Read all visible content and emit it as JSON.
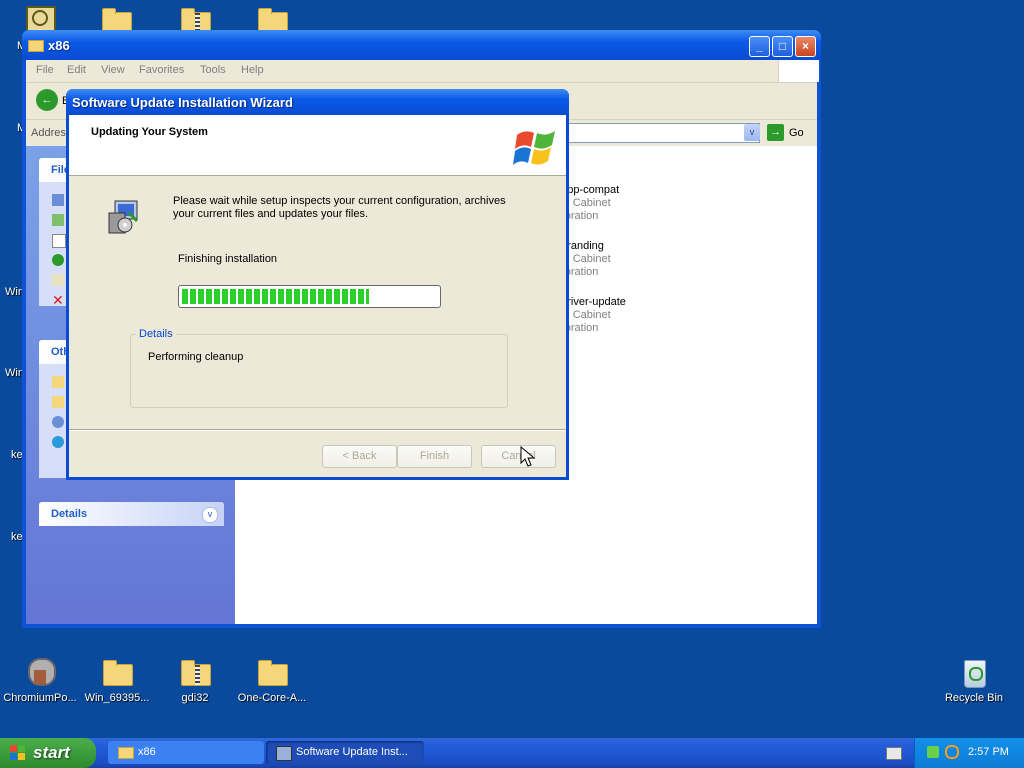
{
  "desktop": {
    "top_icons": [],
    "bottom_icons": [
      {
        "label": "ChromiumPo..."
      },
      {
        "label": "Win_69395..."
      },
      {
        "label": "gdi32"
      },
      {
        "label": "One-Core-A..."
      }
    ],
    "recycle_bin": {
      "label": "Recycle Bin"
    },
    "side_fragments": [
      "M",
      "M",
      "Win",
      "Win",
      "ke",
      "ke"
    ]
  },
  "explorer": {
    "title": "x86",
    "menu": [
      "File",
      "Edit",
      "View",
      "Favorites",
      "Tools",
      "Help"
    ],
    "toolbar": {
      "back_label": "B"
    },
    "address": {
      "label": "Address",
      "go_label": "Go"
    },
    "taskpane": {
      "file_tasks_header": "File",
      "other_places_header": "Oth",
      "details_header": "Details"
    },
    "files": [
      {
        "name": "i-app-compat",
        "line2": "ing Cabinet",
        "line3": "rporation"
      },
      {
        "name": "i-branding",
        "line2": "ing Cabinet",
        "line3": "rporation"
      },
      {
        "name": "i-driver-update",
        "line2": "ing Cabinet",
        "line3": "rporation"
      }
    ]
  },
  "wizard": {
    "title": "Software Update Installation Wizard",
    "header": "Updating Your System",
    "message": "Please wait while setup inspects your current configuration, archives your current files and updates your files.",
    "status": "Finishing installation",
    "progress": 0.74,
    "details_label": "Details",
    "details_text": "Performing cleanup",
    "buttons": {
      "back": "< Back",
      "finish": "Finish",
      "cancel": "Cancel"
    }
  },
  "taskbar": {
    "start_label": "start",
    "tasks": [
      {
        "label": "x86"
      },
      {
        "label": "Software Update Inst..."
      }
    ],
    "clock": "2:57 PM"
  },
  "colors": {
    "desktop": "#0a4a9c",
    "titlebar": "#0b59e8",
    "progress": "#2bd12b",
    "start": "#2e8b2e"
  }
}
